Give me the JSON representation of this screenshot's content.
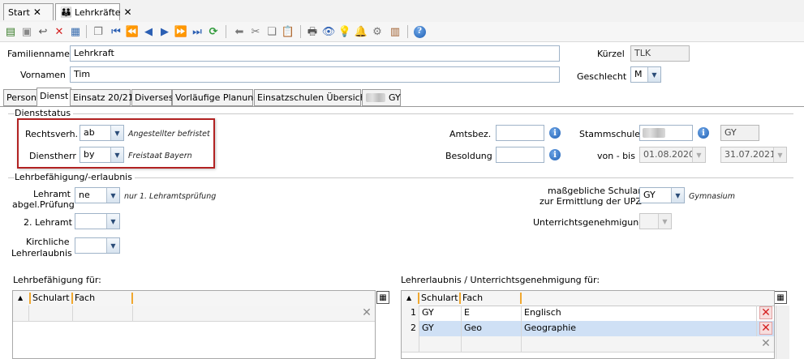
{
  "tabs": {
    "start": "Start",
    "lehrkraefte": "Lehrkräfte",
    "close_symbol": "✕"
  },
  "toolbar": {
    "icons": [
      "new-doc-icon",
      "save-icon",
      "undo-icon",
      "delete-icon",
      "card-icon",
      "copy-icon",
      "first-icon",
      "prev-page-icon",
      "prev-icon",
      "next-icon",
      "next-page-icon",
      "last-icon",
      "refresh-icon",
      "back-arrow-icon",
      "cut-icon",
      "copy-docs-icon",
      "paste-icon",
      "print-icon",
      "preview-icon",
      "bulb-icon",
      "bell-icon",
      "gear-icon",
      "contact-icon",
      "help-icon"
    ]
  },
  "header": {
    "familienname_label": "Familienname",
    "familienname": "Lehrkraft",
    "vornamen_label": "Vornamen",
    "vornamen": "Tim",
    "kuerzel_label": "Kürzel",
    "kuerzel": "TLK",
    "geschlecht_label": "Geschlecht",
    "geschlecht": "M"
  },
  "content_tabs": [
    "Person",
    "Dienst",
    "Einsatz 20/21",
    "Diverses",
    "Vorläufige Planung",
    "Einsatzschulen Übersicht",
    "GY"
  ],
  "dienststatus": {
    "section": "Dienststatus",
    "rechtsverh_label": "Rechtsverh.",
    "rechtsverh": "ab",
    "rechtsverh_desc": "Angestellter befristet",
    "dienstherr_label": "Dienstherr",
    "dienstherr": "by",
    "dienstherr_desc": "Freistaat Bayern",
    "amtsbez_label": "Amtsbez.",
    "amtsbez": "",
    "besoldung_label": "Besoldung",
    "besoldung": "",
    "stammschule_label": "Stammschule",
    "stammschule_type": "GY",
    "vonbis_label": "von - bis",
    "von": "01.08.2020",
    "bis": "31.07.2021"
  },
  "lehrbefaehigung": {
    "section": "Lehrbefähigung/-erlaubnis",
    "lehramt_label_1": "Lehramt",
    "lehramt_label_2": "abgel.Prüfung",
    "lehramt": "ne",
    "lehramt_desc": "nur 1. Lehramtsprüfung",
    "lehramt2_label": "2. Lehramt",
    "kirchliche_label_1": "Kirchliche",
    "kirchliche_label_2": "Lehrerlaubnis",
    "schulart_label_1": "maßgebliche Schulart",
    "schulart_label_2": "zur Ermittlung der UPZ",
    "schulart": "GY",
    "schulart_desc": "Gymnasium",
    "ugenehmigung_label": "Unterrichtsgenehmigung"
  },
  "grid_left": {
    "title": "Lehrbefähigung für:",
    "columns": [
      "Schulart",
      "Fach"
    ]
  },
  "grid_right": {
    "title": "Lehrerlaubnis / Unterrichtsgenehmigung für:",
    "columns": [
      "Schulart",
      "Fach"
    ],
    "rows": [
      {
        "num": "1",
        "schulart": "GY",
        "fach": "E",
        "fach_name": "Englisch"
      },
      {
        "num": "2",
        "schulart": "GY",
        "fach": "Geo",
        "fach_name": "Geographie"
      }
    ]
  },
  "colors": {
    "highlight_border": "#b22222",
    "selected_row": "#cfe0f5",
    "delete_red": "#d42020"
  }
}
